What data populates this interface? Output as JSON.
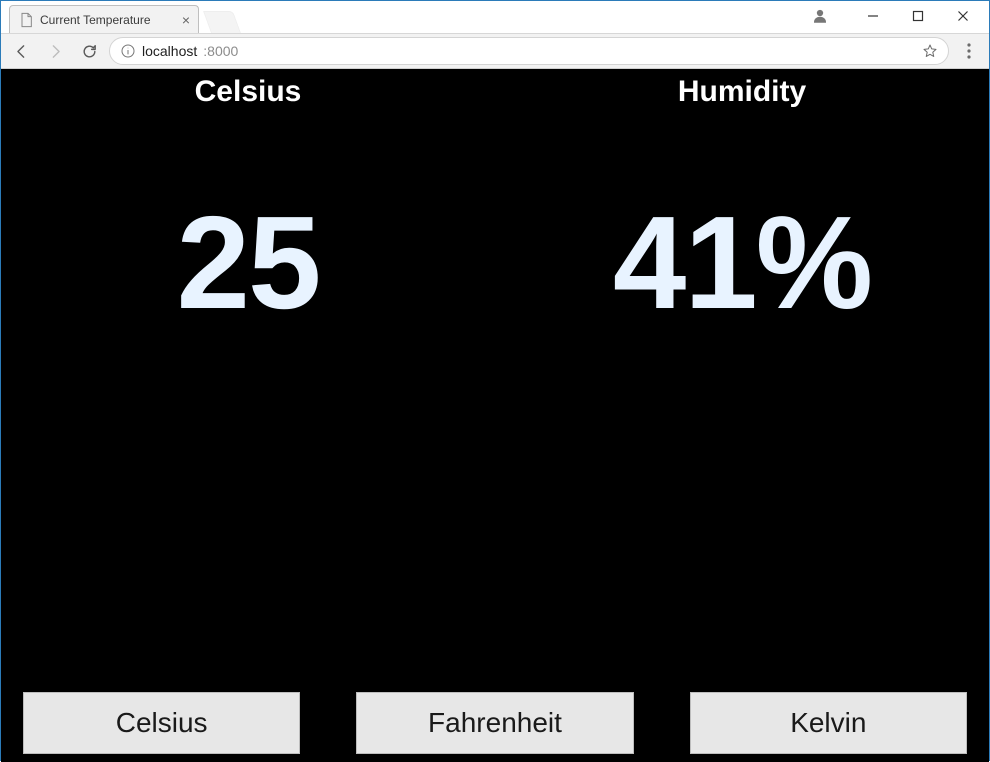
{
  "browser": {
    "tab_title": "Current Temperature",
    "url_host": "localhost",
    "url_port": ":8000"
  },
  "readings": {
    "temperature": {
      "label": "Celsius",
      "value": "25"
    },
    "humidity": {
      "label": "Humidity",
      "value": "41%"
    }
  },
  "buttons": {
    "celsius": "Celsius",
    "fahrenheit": "Fahrenheit",
    "kelvin": "Kelvin"
  }
}
